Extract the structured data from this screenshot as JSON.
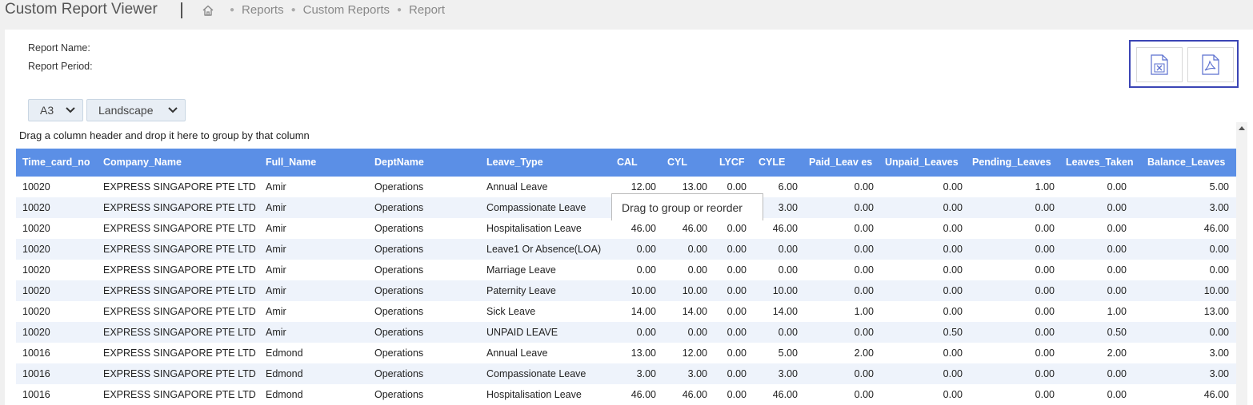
{
  "app": {
    "title": "Custom Report Viewer"
  },
  "breadcrumb": {
    "items": [
      "Reports",
      "Custom Reports",
      "Report"
    ]
  },
  "report": {
    "name_label": "Report Name:",
    "period_label": "Report Period:"
  },
  "export": {
    "excel_icon": "excel-file-icon",
    "pdf_icon": "pdf-file-icon"
  },
  "controls": {
    "page_size": "A3",
    "orientation": "Landscape"
  },
  "grid": {
    "group_hint": "Drag a column header and drop it here to group by that column",
    "tooltip": "Drag to group or reorder",
    "columns": [
      "Time_card_no",
      "Company_Name",
      "Full_Name",
      "DeptName",
      "Leave_Type",
      "CAL",
      "CYL",
      "LYCF",
      "CYLE",
      "Paid_Leav es",
      "Unpaid_Leaves",
      "Pending_Leaves",
      "Leaves_Taken",
      "Balance_Leaves"
    ],
    "rows": [
      [
        "10020",
        "EXPRESS SINGAPORE PTE LTD",
        "Amir",
        "Operations",
        "Annual Leave",
        "12.00",
        "13.00",
        "0.00",
        "6.00",
        "0.00",
        "0.00",
        "1.00",
        "0.00",
        "5.00"
      ],
      [
        "10020",
        "EXPRESS SINGAPORE PTE LTD",
        "Amir",
        "Operations",
        "Compassionate Leave",
        "",
        "",
        "",
        "3.00",
        "0.00",
        "0.00",
        "0.00",
        "0.00",
        "3.00"
      ],
      [
        "10020",
        "EXPRESS SINGAPORE PTE LTD",
        "Amir",
        "Operations",
        "Hospitalisation Leave",
        "46.00",
        "46.00",
        "0.00",
        "46.00",
        "0.00",
        "0.00",
        "0.00",
        "0.00",
        "46.00"
      ],
      [
        "10020",
        "EXPRESS SINGAPORE PTE LTD",
        "Amir",
        "Operations",
        "Leave1 Or Absence(LOA)",
        "0.00",
        "0.00",
        "0.00",
        "0.00",
        "0.00",
        "0.00",
        "0.00",
        "0.00",
        "0.00"
      ],
      [
        "10020",
        "EXPRESS SINGAPORE PTE LTD",
        "Amir",
        "Operations",
        "Marriage Leave",
        "0.00",
        "0.00",
        "0.00",
        "0.00",
        "0.00",
        "0.00",
        "0.00",
        "0.00",
        "0.00"
      ],
      [
        "10020",
        "EXPRESS SINGAPORE PTE LTD",
        "Amir",
        "Operations",
        "Paternity Leave",
        "10.00",
        "10.00",
        "0.00",
        "10.00",
        "0.00",
        "0.00",
        "0.00",
        "0.00",
        "10.00"
      ],
      [
        "10020",
        "EXPRESS SINGAPORE PTE LTD",
        "Amir",
        "Operations",
        "Sick Leave",
        "14.00",
        "14.00",
        "0.00",
        "14.00",
        "1.00",
        "0.00",
        "0.00",
        "1.00",
        "13.00"
      ],
      [
        "10020",
        "EXPRESS SINGAPORE PTE LTD",
        "Amir",
        "Operations",
        "UNPAID LEAVE",
        "0.00",
        "0.00",
        "0.00",
        "0.00",
        "0.00",
        "0.50",
        "0.00",
        "0.50",
        "0.00"
      ],
      [
        "10016",
        "EXPRESS SINGAPORE PTE LTD",
        "Edmond",
        "Operations",
        "Annual Leave",
        "13.00",
        "12.00",
        "0.00",
        "5.00",
        "2.00",
        "0.00",
        "0.00",
        "2.00",
        "3.00"
      ],
      [
        "10016",
        "EXPRESS SINGAPORE PTE LTD",
        "Edmond",
        "Operations",
        "Compassionate Leave",
        "3.00",
        "3.00",
        "0.00",
        "3.00",
        "0.00",
        "0.00",
        "0.00",
        "0.00",
        "3.00"
      ],
      [
        "10016",
        "EXPRESS SINGAPORE PTE LTD",
        "Edmond",
        "Operations",
        "Hospitalisation Leave",
        "46.00",
        "46.00",
        "0.00",
        "46.00",
        "0.00",
        "0.00",
        "0.00",
        "0.00",
        "46.00"
      ]
    ]
  }
}
